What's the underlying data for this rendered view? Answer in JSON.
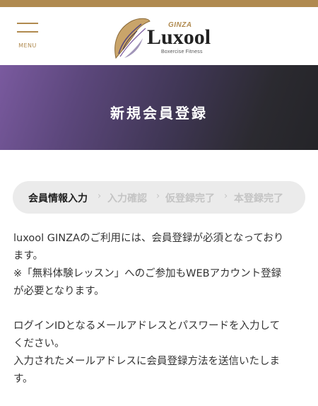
{
  "header": {
    "menu_label": "MENU",
    "logo": {
      "ginza": "GINZA",
      "word": "Luxool",
      "sub": "Boxercise Fitness"
    }
  },
  "hero": {
    "title": "新規会員登録"
  },
  "steps": [
    {
      "label": "会員情報入力",
      "active": true
    },
    {
      "label": "入力確認",
      "active": false
    },
    {
      "label": "仮登録完了",
      "active": false
    },
    {
      "label": "本登録完了",
      "active": false
    }
  ],
  "content": {
    "para1_line1": "luxool GINZAのご利用には、会員登録が必須となっており",
    "para1_line2": "ます。",
    "para1_line3": "※「無料体験レッスン」へのご参加もWEBアカウント登録",
    "para1_line4": "が必要となります。",
    "para2_line1": "ログインIDとなるメールアドレスとパスワードを入力して",
    "para2_line2": "ください。",
    "para2_line3": "入力されたメールアドレスに会員登録方法を送信いたしま",
    "para2_line4": "す。"
  },
  "colors": {
    "accent_gold": "#b08a4f",
    "hero_start": "#7a5a9f",
    "hero_end": "#242428"
  }
}
